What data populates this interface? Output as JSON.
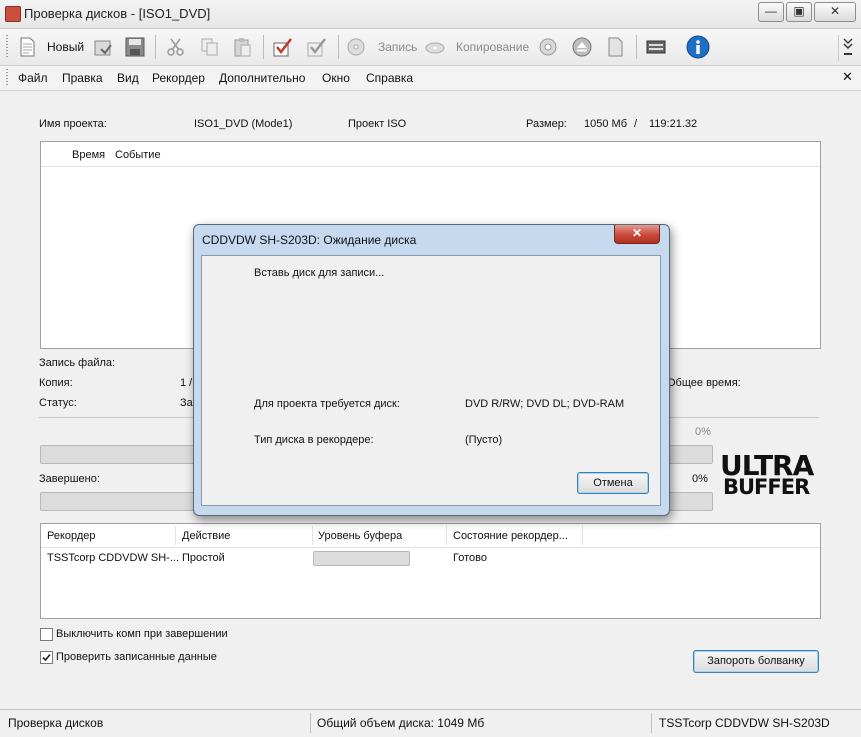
{
  "window": {
    "title": "Проверка дисков - [ISO1_DVD]"
  },
  "toolbar": {
    "new_label": "Новый",
    "burn_label": "Запись",
    "copy_label": "Копирование"
  },
  "menu": [
    "Файл",
    "Правка",
    "Вид",
    "Рекордер",
    "Дополнительно",
    "Окно",
    "Справка"
  ],
  "project": {
    "name_label": "Имя проекта:",
    "name_value": "ISO1_DVD (Mode1)",
    "type": "Проект ISO",
    "size_label": "Размер:",
    "size_value": "1050 Мб",
    "separator": "/",
    "duration": "119:21.32"
  },
  "log": {
    "col_time": "Время",
    "col_event": "Событие"
  },
  "info": {
    "file_label": "Запись файла:",
    "copy_label": "Копия:",
    "copy_value": "1 /",
    "status_label": "Статус:",
    "status_value": "За",
    "total_time_label": "Общее время:",
    "progress1_pct": "0%",
    "completed_label": "Завершено:",
    "progress2_pct": "0%"
  },
  "logo": {
    "line1": "ULTRA",
    "line2": "BUFFER"
  },
  "recorders": {
    "columns": [
      "Рекордер",
      "Действие",
      "Уровень буфера",
      "Состояние рекордер..."
    ],
    "rows": [
      {
        "recorder": "TSSTcorp CDDVDW SH-...",
        "action": "Простой",
        "buffer_level": 0,
        "state": "Готово"
      }
    ]
  },
  "options": {
    "shutdown_label": "Выключить комп при завершении",
    "shutdown_checked": false,
    "verify_label": "Проверить записанные данные",
    "verify_checked": true
  },
  "fire_button": "Запороть болванку",
  "statusbar": {
    "left": "Проверка дисков",
    "middle": "Общий объем диска: 1049 Мб",
    "right": "TSSTcorp CDDVDW SH-S203D"
  },
  "dialog": {
    "title": "CDDVDW SH-S203D: Ожидание диска",
    "message": "Вставь диск для записи...",
    "required_label": "Для проекта требуется диск:",
    "required_value": "DVD R/RW; DVD DL; DVD-RAM",
    "current_label": "Тип диска в рекордере:",
    "current_value": "(Пусто)",
    "cancel_label": "Отмена"
  },
  "colors": {
    "dialog_close": "#c9483a",
    "info_icon": "#1f6fc4"
  }
}
